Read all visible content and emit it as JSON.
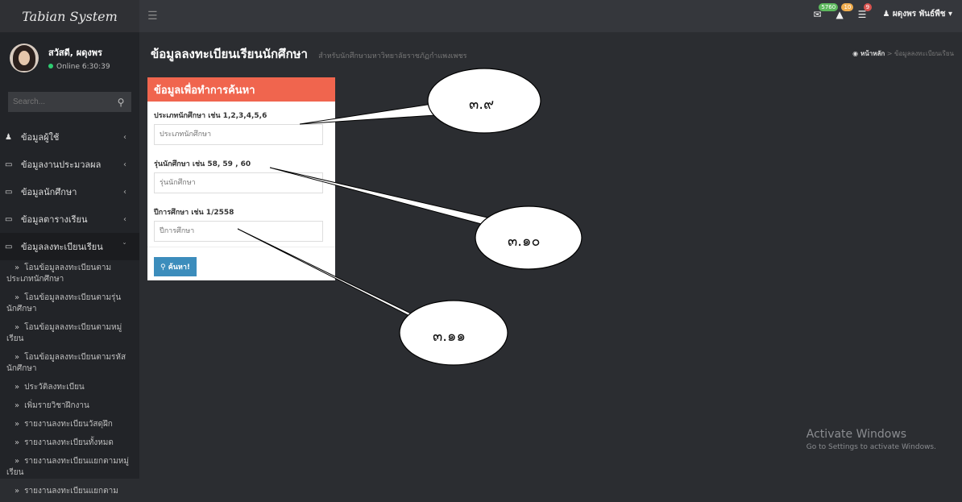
{
  "app": {
    "title": "Tabian System"
  },
  "user": {
    "greeting": "สวัสดี, ผดุงพร",
    "status": "Online 6:30:39"
  },
  "search": {
    "placeholder": "Search..."
  },
  "sidebar": {
    "items": [
      {
        "label": "ข้อมูลผู้ใช้"
      },
      {
        "label": "ข้อมูลงานประมวลผล"
      },
      {
        "label": "ข้อมูลนักศึกษา"
      },
      {
        "label": "ข้อมูลตารางเรียน"
      },
      {
        "label": "ข้อมูลลงทะเบียนเรียน"
      }
    ],
    "subitems": [
      {
        "label": "โอนข้อมูลลงทะเบียนตามประเภทนักศึกษา"
      },
      {
        "label": "โอนข้อมูลลงทะเบียนตามรุ่นนักศึกษา"
      },
      {
        "label": "โอนข้อมูลลงทะเบียนตามหมู่เรียน"
      },
      {
        "label": "โอนข้อมูลลงทะเบียนตามรหัสนักศึกษา"
      },
      {
        "label": "ประวัติลงทะเบียน"
      },
      {
        "label": "เพิ่มรายวิชาฝึกงาน"
      },
      {
        "label": "รายงานลงทะเบียนวัสดุฝึก"
      },
      {
        "label": "รายงานลงทะเบียนทั้งหมด"
      },
      {
        "label": "รายงานลงทะเบียนแยกตามหมู่เรียน"
      },
      {
        "label": "รายงานลงทะเบียนแยกตาม"
      }
    ]
  },
  "topbar": {
    "mail_count": "5760",
    "alert_count": "10",
    "task_count": "9",
    "user_name": "ผดุงพร พันธ์พืช"
  },
  "page": {
    "title": "ข้อมูลลงทะเบียนเรียนนักศึกษา",
    "subtitle": "สำหรับนักศึกษามหาวิทยาลัยราชภัฏกำแพงเพชร",
    "breadcrumb_home": "หน้าหลัก",
    "breadcrumb_sep": ">",
    "breadcrumb_current": "ข้อมูลลงทะเบียนเรียน"
  },
  "form": {
    "header": "ข้อมูลเพื่อทำการค้นหา",
    "fields": [
      {
        "label": "ประเภทนักศึกษา เช่น 1,2,3,4,5,6",
        "placeholder": "ประเภทนักศึกษา"
      },
      {
        "label": "รุ่นนักศึกษา เช่น 58, 59 , 60",
        "placeholder": "รุ่นนักศึกษา"
      },
      {
        "label": "ปีการศึกษา เช่น 1/2558",
        "placeholder": "ปีการศึกษา"
      }
    ],
    "submit_label": "ค้นหา!"
  },
  "callouts": [
    "๓.๙",
    "๓.๑๐",
    "๓.๑๑"
  ],
  "watermark": {
    "line1": "Activate Windows",
    "line2": "Go to Settings to activate Windows."
  }
}
